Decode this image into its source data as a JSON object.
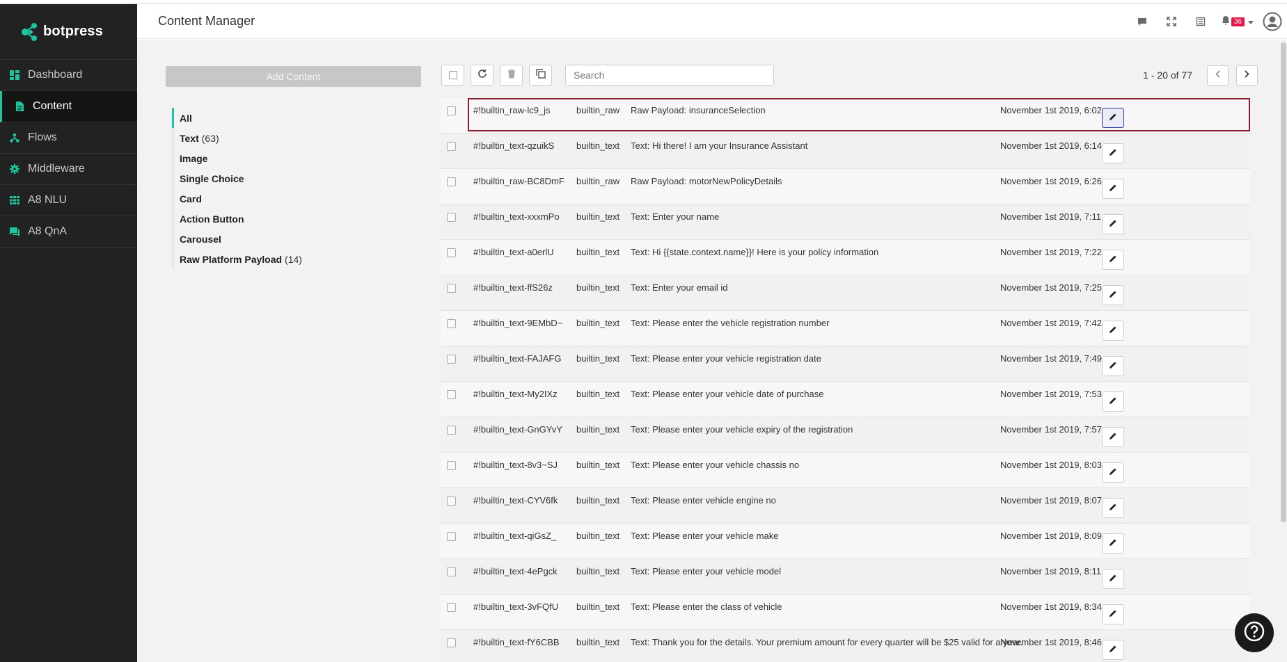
{
  "app": {
    "brand": "botpress",
    "page_title": "Content Manager"
  },
  "sidebar": {
    "items": [
      {
        "label": "Dashboard",
        "icon": "dashboard-icon"
      },
      {
        "label": "Content",
        "icon": "document-icon",
        "active": true
      },
      {
        "label": "Flows",
        "icon": "flows-icon"
      },
      {
        "label": "Middleware",
        "icon": "gear-icon"
      },
      {
        "label": "A8 NLU",
        "icon": "grid-icon"
      },
      {
        "label": "A8 QnA",
        "icon": "chat-icon"
      }
    ]
  },
  "header": {
    "notification_count": "36"
  },
  "content": {
    "add_button": "Add Content",
    "categories": [
      {
        "label": "All",
        "count": ""
      },
      {
        "label": "Text",
        "count": "(63)"
      },
      {
        "label": "Image",
        "count": ""
      },
      {
        "label": "Single Choice",
        "count": ""
      },
      {
        "label": "Card",
        "count": ""
      },
      {
        "label": "Action Button",
        "count": ""
      },
      {
        "label": "Carousel",
        "count": ""
      },
      {
        "label": "Raw Platform Payload",
        "count": "(14)"
      }
    ],
    "search_placeholder": "Search",
    "pagination": "1 - 20 of 77",
    "rows": [
      {
        "id": "#!builtin_raw-lc9_js",
        "type": "builtin_raw",
        "preview": "Raw Payload: insuranceSelection",
        "date": "November 1st 2019, 6:02"
      },
      {
        "id": "#!builtin_text-qzuikS",
        "type": "builtin_text",
        "preview": "Text: Hi there! I am your Insurance Assistant",
        "date": "November 1st 2019, 6:14"
      },
      {
        "id": "#!builtin_raw-BC8DmF",
        "type": "builtin_raw",
        "preview": "Raw Payload: motorNewPolicyDetails",
        "date": "November 1st 2019, 6:26"
      },
      {
        "id": "#!builtin_text-xxxmPo",
        "type": "builtin_text",
        "preview": "Text: Enter your name",
        "date": "November 1st 2019, 7:11"
      },
      {
        "id": "#!builtin_text-a0erlU",
        "type": "builtin_text",
        "preview": "Text: Hi {{state.context.name}}! Here is your policy information",
        "date": "November 1st 2019, 7:22"
      },
      {
        "id": "#!builtin_text-ffS26z",
        "type": "builtin_text",
        "preview": "Text: Enter your email id",
        "date": "November 1st 2019, 7:25"
      },
      {
        "id": "#!builtin_text-9EMbD~",
        "type": "builtin_text",
        "preview": "Text: Please enter the vehicle registration number",
        "date": "November 1st 2019, 7:42"
      },
      {
        "id": "#!builtin_text-FAJAFG",
        "type": "builtin_text",
        "preview": "Text: Please enter your vehicle registration date",
        "date": "November 1st 2019, 7:49"
      },
      {
        "id": "#!builtin_text-My2IXz",
        "type": "builtin_text",
        "preview": "Text: Please enter your vehicle date of purchase",
        "date": "November 1st 2019, 7:53"
      },
      {
        "id": "#!builtin_text-GnGYvY",
        "type": "builtin_text",
        "preview": "Text: Please enter your vehicle expiry of the registration",
        "date": "November 1st 2019, 7:57"
      },
      {
        "id": "#!builtin_text-8v3~SJ",
        "type": "builtin_text",
        "preview": "Text: Please enter your vehicle chassis no",
        "date": "November 1st 2019, 8:03"
      },
      {
        "id": "#!builtin_text-CYV6fk",
        "type": "builtin_text",
        "preview": "Text: Please enter vehicle engine no",
        "date": "November 1st 2019, 8:07"
      },
      {
        "id": "#!builtin_text-qiGsZ_",
        "type": "builtin_text",
        "preview": "Text: Please enter your vehicle make",
        "date": "November 1st 2019, 8:09"
      },
      {
        "id": "#!builtin_text-4ePgck",
        "type": "builtin_text",
        "preview": "Text: Please enter your vehicle model",
        "date": "November 1st 2019, 8:11"
      },
      {
        "id": "#!builtin_text-3vFQfU",
        "type": "builtin_text",
        "preview": "Text: Please enter the class of vehicle",
        "date": "November 1st 2019, 8:34"
      },
      {
        "id": "#!builtin_text-fY6CBB",
        "type": "builtin_text",
        "preview": "Text: Thank you for the details. Your premium amount for every quarter will be $25 valid for a year.",
        "date": "November 1st 2019, 8:46"
      }
    ]
  },
  "colors": {
    "accent": "#1ec3a0",
    "sidebar_bg": "#222222",
    "badge": "#e5174b",
    "selection": "#8b1a2b"
  }
}
